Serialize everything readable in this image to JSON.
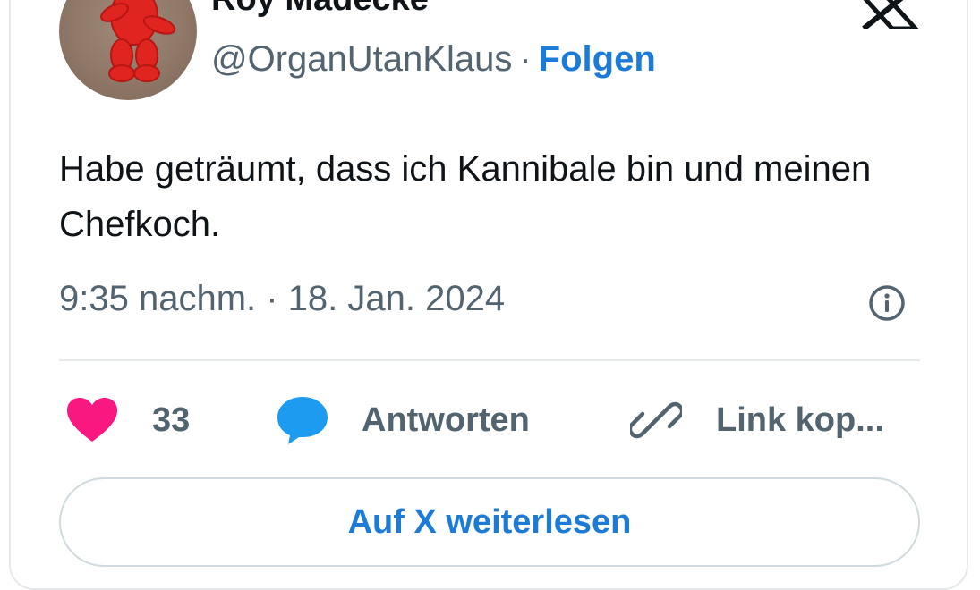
{
  "author": {
    "display_name": "Roy Madecke",
    "handle": "@OrganUtanKlaus",
    "separator": "·",
    "follow_label": "Folgen"
  },
  "tweet": {
    "text": "Habe geträumt, dass ich Kannibale bin und meinen Chefkoch.",
    "timestamp": "9:35 nachm. · 18. Jan. 2024"
  },
  "actions": {
    "like_count": "33",
    "reply_label": "Antworten",
    "copy_link_label": "Link kop..."
  },
  "read_more_label": "Auf X weiterlesen",
  "colors": {
    "like": "#f91880",
    "reply": "#1d9bf0",
    "link": "#1d7bd8",
    "text": "#0f1419",
    "muted": "#536471"
  },
  "icons": [
    "x-logo-icon",
    "info-icon",
    "heart-icon",
    "speech-bubble-icon",
    "link-icon"
  ]
}
